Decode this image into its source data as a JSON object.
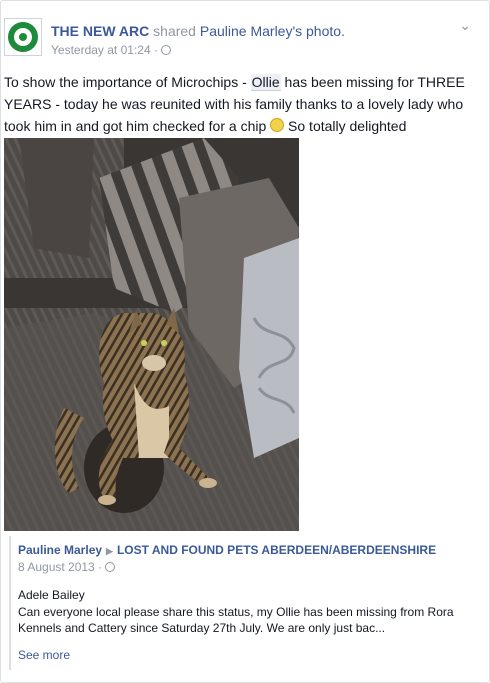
{
  "post": {
    "page_name": "THE NEW ARC",
    "shared_text": "shared",
    "shared_person": "Pauline Marley's photo.",
    "timestamp": "Yesterday at 01:24 ·",
    "text_before": "To show the importance of Microchips - ",
    "tagged": "Ollie",
    "text_after": " has been missing for THREE YEARS - today he was reunited with his family thanks to a lovely lady who took him in and got him checked for a chip ",
    "text_end": " So totally delighted"
  },
  "shared": {
    "author": "Pauline Marley",
    "group": "LOST AND FOUND PETS ABERDEEN/ABERDEENSHIRE",
    "date": "8 August 2013 ·",
    "inner_author": "Adele Bailey",
    "body": "Can everyone local please share this status, my Ollie has been missing from Rora Kennels and Cattery since Saturday 27th July. We are only just bac...",
    "see_more": "See more"
  },
  "icons": {
    "avatar": "the-new-arc-logo",
    "options": "chevron-down-icon",
    "privacy": "globe-icon",
    "emoji": "smiley-icon",
    "arrow": "right-arrow-icon"
  },
  "colors": {
    "link": "#3b5998",
    "meta": "#9197a3",
    "text": "#141823",
    "logo_green": "#1e8a3c"
  }
}
